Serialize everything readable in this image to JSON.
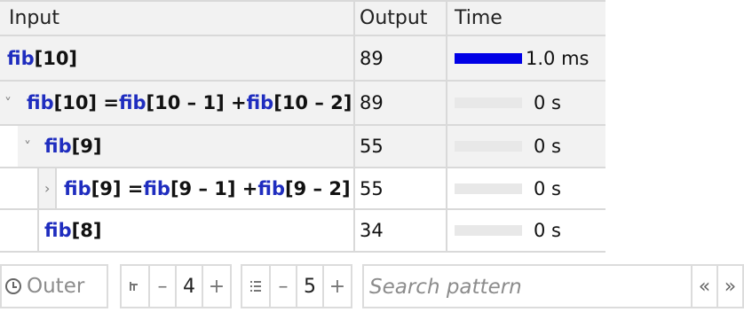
{
  "table": {
    "headers": {
      "input": "Input",
      "output": "Output",
      "time": "Time"
    },
    "rows": [
      {
        "parts": [
          {
            "t": "fib",
            "fn": true
          },
          {
            "t": "[10]",
            "fn": false
          }
        ],
        "output": "89",
        "bar_fraction": 1.0,
        "time": "1.0 ms",
        "expander": ""
      },
      {
        "parts": [
          {
            "t": "fib",
            "fn": true
          },
          {
            "t": "[10] = ",
            "fn": false
          },
          {
            "t": "fib",
            "fn": true
          },
          {
            "t": "[10 – 1] + ",
            "fn": false
          },
          {
            "t": "fib",
            "fn": true
          },
          {
            "t": "[10 – 2]",
            "fn": false
          }
        ],
        "output": "89",
        "bar_fraction": 0,
        "time": "0 s",
        "expander": "˅"
      },
      {
        "parts": [
          {
            "t": "fib",
            "fn": true
          },
          {
            "t": "[9]",
            "fn": false
          }
        ],
        "output": "55",
        "bar_fraction": 0,
        "time": "0 s",
        "expander": "˅"
      },
      {
        "parts": [
          {
            "t": "fib",
            "fn": true
          },
          {
            "t": "[9] = ",
            "fn": false
          },
          {
            "t": "fib",
            "fn": true
          },
          {
            "t": "[9 – 1] + ",
            "fn": false
          },
          {
            "t": "fib",
            "fn": true
          },
          {
            "t": "[9 – 2]",
            "fn": false
          }
        ],
        "output": "55",
        "bar_fraction": 0,
        "time": "0 s",
        "expander": "›"
      },
      {
        "parts": [
          {
            "t": "fib",
            "fn": true
          },
          {
            "t": "[8]",
            "fn": false
          }
        ],
        "output": "34",
        "bar_fraction": 0,
        "time": "0 s",
        "expander": ""
      }
    ]
  },
  "toolbar": {
    "outer_label": "Outer",
    "outer_icon": "clock-icon",
    "depth": {
      "icon": "tree-depth-icon",
      "minus": "–",
      "value": "4",
      "plus": "+"
    },
    "count": {
      "icon": "list-icon",
      "minus": "–",
      "value": "5",
      "plus": "+"
    },
    "search": {
      "placeholder": "Search pattern",
      "value": ""
    },
    "prev_label": "«",
    "next_label": "»"
  },
  "colors": {
    "function": "#1f2dbf",
    "bar": "#0000e6",
    "row_bg": "#f2f2f2",
    "border": "#d9d9d9"
  }
}
